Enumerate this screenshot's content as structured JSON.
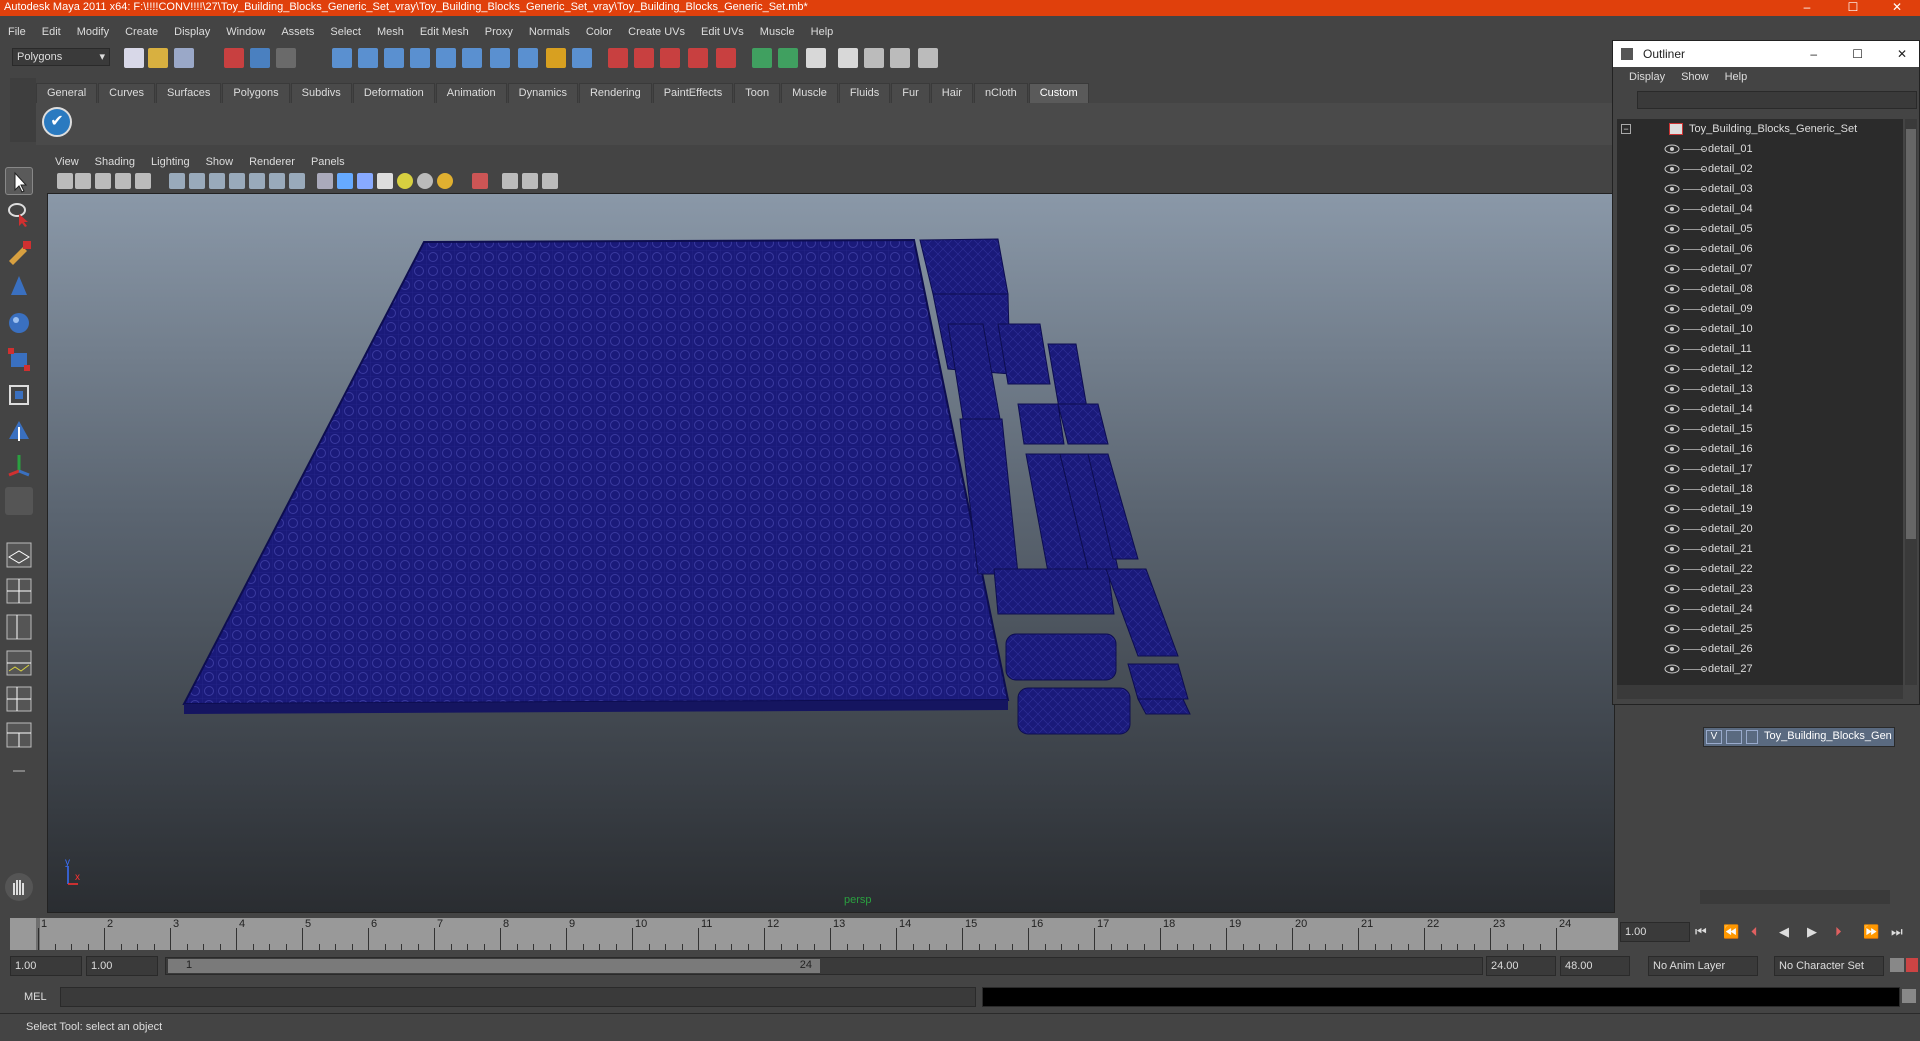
{
  "window": {
    "title": "Autodesk Maya 2011 x64: F:\\!!!!CONV!!!!\\27\\Toy_Building_Blocks_Generic_Set_vray\\Toy_Building_Blocks_Generic_Set_vray\\Toy_Building_Blocks_Generic_Set.mb*",
    "minimize": "–",
    "maximize": "☐",
    "close": "✕"
  },
  "menubar": [
    "File",
    "Edit",
    "Modify",
    "Create",
    "Display",
    "Window",
    "Assets",
    "Select",
    "Mesh",
    "Edit Mesh",
    "Proxy",
    "Normals",
    "Color",
    "Create UVs",
    "Edit UVs",
    "Muscle",
    "Help"
  ],
  "statusline": {
    "mode": "Polygons"
  },
  "shelf_tabs": [
    "General",
    "Curves",
    "Surfaces",
    "Polygons",
    "Subdivs",
    "Deformation",
    "Animation",
    "Dynamics",
    "Rendering",
    "PaintEffects",
    "Toon",
    "Muscle",
    "Fluids",
    "Fur",
    "Hair",
    "nCloth",
    "Custom"
  ],
  "shelf_active": "Custom",
  "viewport": {
    "menu": [
      "View",
      "Shading",
      "Lighting",
      "Show",
      "Renderer",
      "Panels"
    ],
    "camera_label": "persp",
    "wire_color": "#1a1a7a"
  },
  "outliner": {
    "title": "Outliner",
    "menu": [
      "Display",
      "Show",
      "Help"
    ],
    "root": "Toy_Building_Blocks_Generic_Set",
    "items": [
      "detail_01",
      "detail_02",
      "detail_03",
      "detail_04",
      "detail_05",
      "detail_06",
      "detail_07",
      "detail_08",
      "detail_09",
      "detail_10",
      "detail_11",
      "detail_12",
      "detail_13",
      "detail_14",
      "detail_15",
      "detail_16",
      "detail_17",
      "detail_18",
      "detail_19",
      "detail_20",
      "detail_21",
      "detail_22",
      "detail_23",
      "detail_24",
      "detail_25",
      "detail_26",
      "detail_27"
    ]
  },
  "layers": {
    "visible_flag": "V",
    "layer_name": "Toy_Building_Blocks_Gen"
  },
  "timeline": {
    "ticks": [
      "1",
      "2",
      "3",
      "4",
      "5",
      "6",
      "7",
      "8",
      "9",
      "10",
      "11",
      "12",
      "13",
      "14",
      "15",
      "16",
      "17",
      "18",
      "19",
      "20",
      "21",
      "22",
      "23",
      "24"
    ],
    "current_frame": "1.00",
    "start_time": "1.00",
    "start_range": "1.00",
    "range_start_label": "1",
    "range_end_label": "24",
    "end_range": "24.00",
    "end_time": "48.00",
    "anim_layer": "No Anim Layer",
    "character_set": "No Character Set"
  },
  "cmdline": {
    "label": "MEL"
  },
  "helpline": {
    "text": "Select Tool: select an object"
  },
  "colors": {
    "title_bar": "#e0400c",
    "layer_color": "#5a6a80"
  }
}
